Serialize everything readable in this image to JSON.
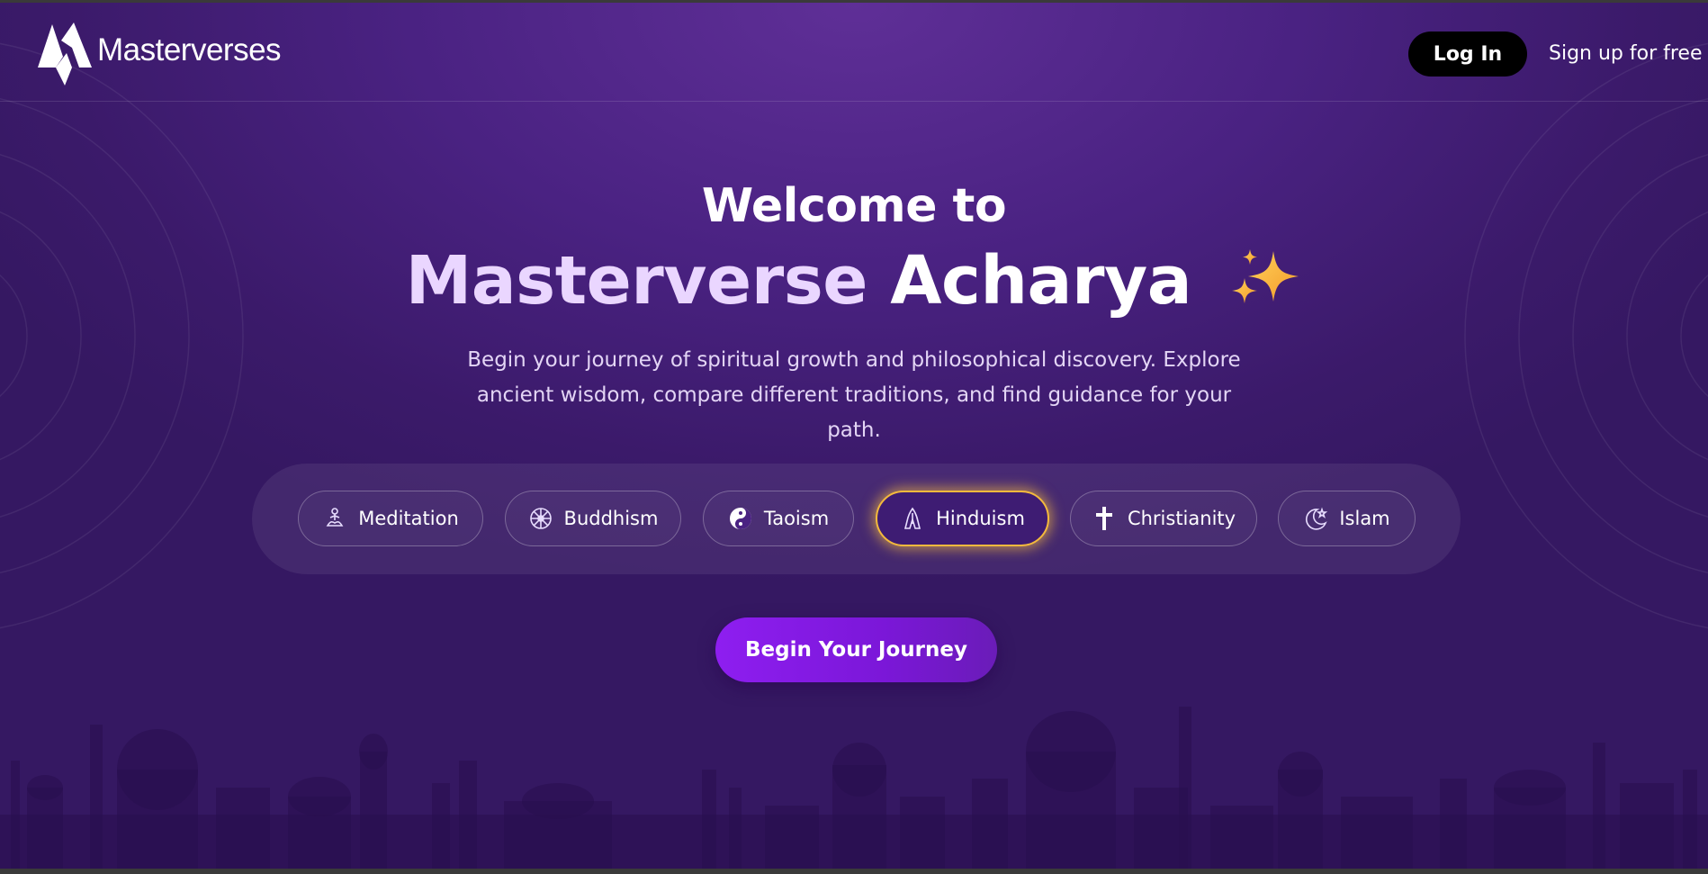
{
  "brand": {
    "name": "Masterverses"
  },
  "nav": {
    "login_label": "Log In",
    "signup_label": "Sign up for free"
  },
  "hero": {
    "welcome": "Welcome to",
    "headline_part1": "Masterverse",
    "headline_part2": "Acharya",
    "description_line1": "Begin your journey of spiritual growth and philosophical discovery. Explore",
    "description_line2": "ancient wisdom, compare different traditions, and find guidance for your path."
  },
  "traditions": [
    {
      "label": "Meditation",
      "icon": "meditation-icon",
      "active": false
    },
    {
      "label": "Buddhism",
      "icon": "dharma-wheel-icon",
      "active": false
    },
    {
      "label": "Taoism",
      "icon": "yin-yang-icon",
      "active": false
    },
    {
      "label": "Hinduism",
      "icon": "om-praying-hands-icon",
      "active": true
    },
    {
      "label": "Christianity",
      "icon": "cross-icon",
      "active": false
    },
    {
      "label": "Islam",
      "icon": "crescent-star-icon",
      "active": false
    }
  ],
  "cta": {
    "label": "Begin Your Journey"
  },
  "colors": {
    "background": "#4a2282",
    "accent_gold": "#f3b93d",
    "cta_purple": "#8e1ef0",
    "headline_lavender": "#ead6ff"
  }
}
